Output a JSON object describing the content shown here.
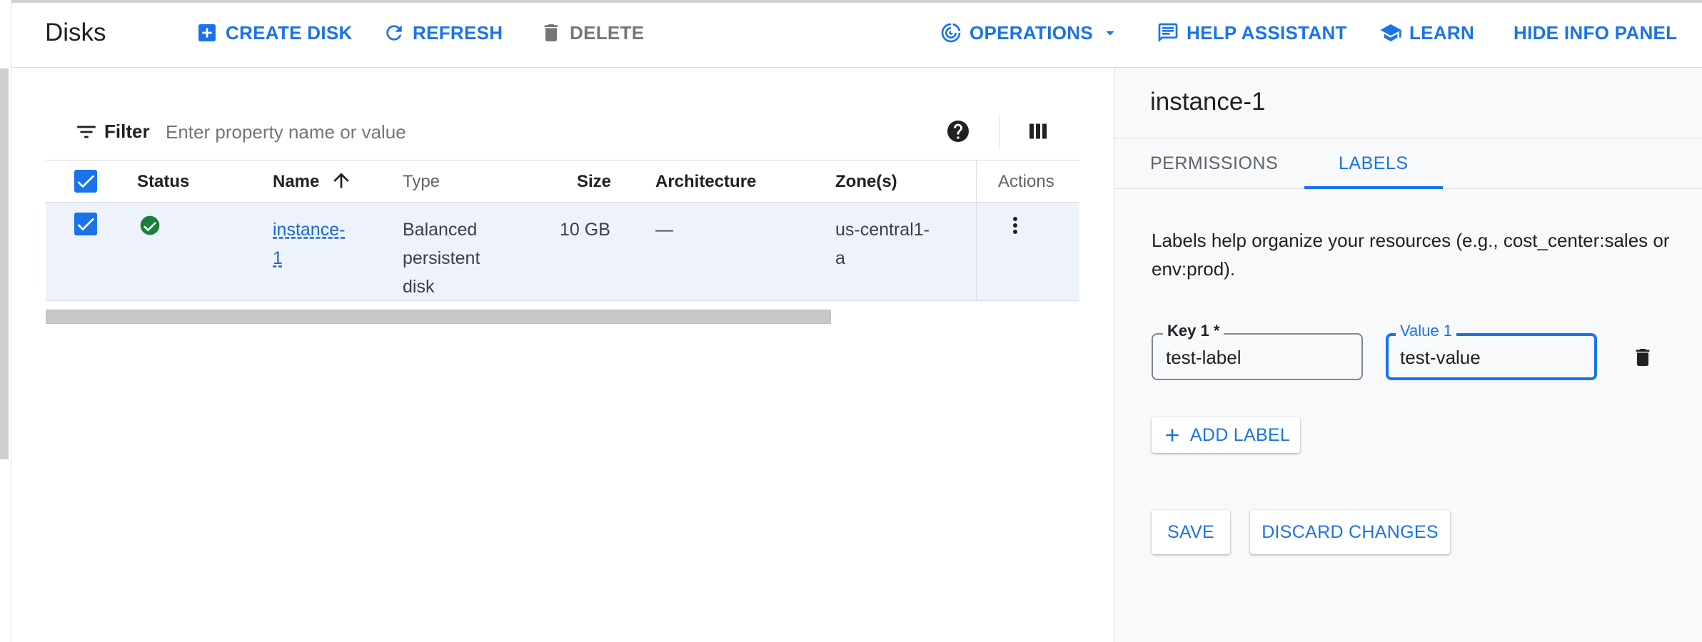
{
  "header": {
    "title": "Disks",
    "create_disk": "CREATE DISK",
    "refresh": "REFRESH",
    "delete": "DELETE",
    "operations": "OPERATIONS",
    "help_assistant": "HELP ASSISTANT",
    "learn": "LEARN",
    "hide_info_panel": "HIDE INFO PANEL"
  },
  "filter": {
    "label": "Filter",
    "placeholder": "Enter property name or value"
  },
  "table": {
    "columns": {
      "status": "Status",
      "name": "Name",
      "type": "Type",
      "size": "Size",
      "architecture": "Architecture",
      "zones": "Zone(s)",
      "actions": "Actions"
    },
    "rows": [
      {
        "selected": true,
        "status": "ok",
        "name_line1": "instance-",
        "name_line2": "1",
        "type_line1": "Balanced",
        "type_line2": "persistent",
        "type_line3": "disk",
        "size": "10 GB",
        "architecture": "—",
        "zone_line1": "us-central1-",
        "zone_line2": "a"
      }
    ]
  },
  "info_panel": {
    "title": "instance-1",
    "tabs": {
      "permissions": "PERMISSIONS",
      "labels": "LABELS"
    },
    "active_tab": "LABELS",
    "description": "Labels help organize your resources (e.g., cost_center:sales or env:prod).",
    "key_label": "Key 1 *",
    "key_value": "test-label",
    "value_label": "Value 1",
    "value_value": "test-value",
    "add_label": "ADD LABEL",
    "save": "SAVE",
    "discard": "DISCARD CHANGES"
  },
  "colors": {
    "accent": "#1a73e8",
    "success": "#188038",
    "selected_row": "#eef3fb"
  }
}
